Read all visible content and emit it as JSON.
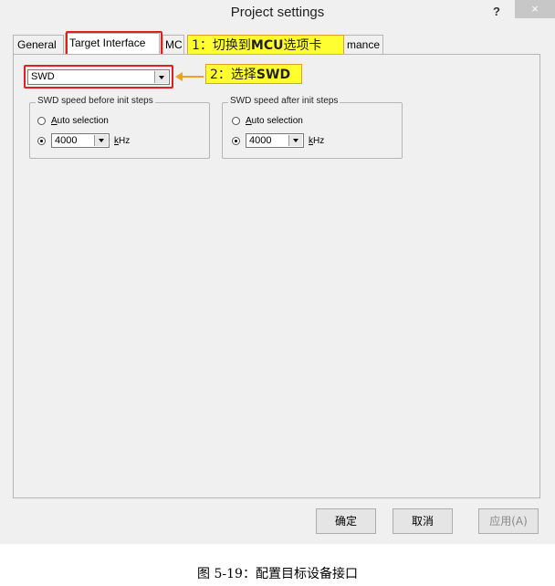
{
  "window": {
    "title": "Project settings",
    "help_label": "?",
    "close_label": "×"
  },
  "tabs": [
    {
      "label": "General"
    },
    {
      "label": "Target Interface"
    },
    {
      "label": "MC"
    },
    {
      "label": "mance"
    }
  ],
  "annotations": {
    "step1_prefix": "1：切换到",
    "step1_bold": "MCU",
    "step1_suffix": "选项卡",
    "step2_prefix": "2：选择",
    "step2_bold": "SWD"
  },
  "interface_select": {
    "value": "SWD"
  },
  "speed_before": {
    "label": "SWD speed before init steps",
    "auto_label_u": "A",
    "auto_label_rest": "uto selection",
    "value": "4000",
    "unit_u": "k",
    "unit_rest": "Hz",
    "selected": "manual"
  },
  "speed_after": {
    "label": "SWD speed after init steps",
    "auto_label_u": "A",
    "auto_label_rest": "uto selection",
    "value": "4000",
    "unit_u": "k",
    "unit_rest": "Hz",
    "selected": "manual"
  },
  "buttons": {
    "ok": "确定",
    "cancel": "取消",
    "apply": "应用(A)"
  },
  "caption": "图 5-19：配置目标设备接口",
  "colors": {
    "highlight": "#ffff30",
    "callout_border": "#e02020",
    "arrow": "#f0a020"
  }
}
